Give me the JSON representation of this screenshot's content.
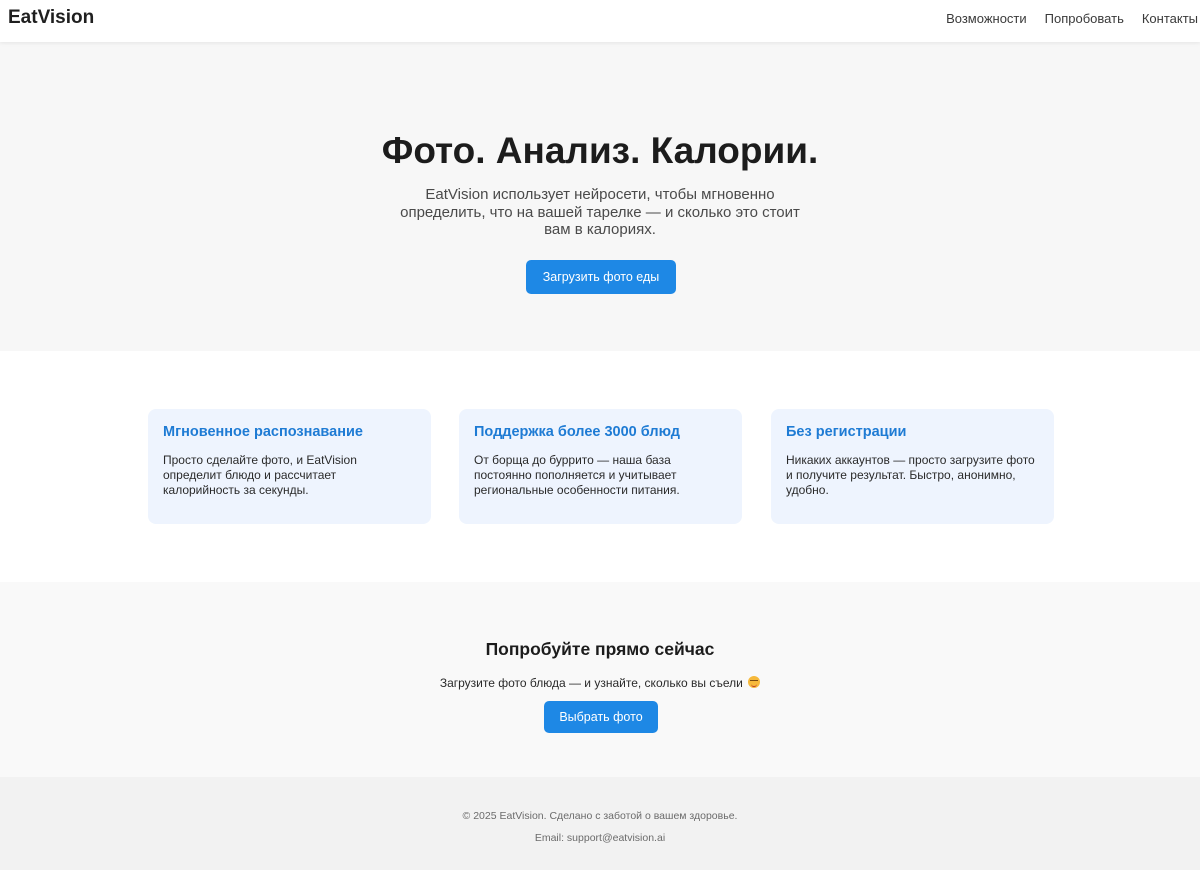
{
  "header": {
    "logo": "EatVision",
    "nav": [
      {
        "label": "Возможности"
      },
      {
        "label": "Попробовать"
      },
      {
        "label": "Контакты"
      }
    ]
  },
  "hero": {
    "title": "Фото. Анализ. Калории.",
    "subtitle": "EatVision использует нейросети, чтобы мгновенно определить, что на вашей тарелке — и сколько это стоит вам в калориях.",
    "button_label": "Загрузить фото еды"
  },
  "features": [
    {
      "title": "Мгновенное распознавание",
      "text": "Просто сделайте фото, и EatVision определит блюдо и рассчитает калорийность за секунды."
    },
    {
      "title": "Поддержка более 3000 блюд",
      "text": "От борща до буррито — наша база постоянно пополняется и учитывает региональные особенности питания."
    },
    {
      "title": "Без регистрации",
      "text": "Никаких аккаунтов — просто загрузите фото и получите результат. Быстро, анонимно, удобно."
    }
  ],
  "try": {
    "title": "Попробуйте прямо сейчас",
    "text": "Загрузите фото блюда — и узнайте, сколько вы съели",
    "emoji_icon": "grinning-face-emoji",
    "button_label": "Выбрать фото"
  },
  "footer": {
    "copyright": "© 2025 EatVision. Сделано с заботой о вашем здоровье.",
    "email": "Email: support@eatvision.ai"
  },
  "colors": {
    "accent": "#1e88e5",
    "card_background": "#eef4fe",
    "card_title": "#1e7bd4"
  }
}
